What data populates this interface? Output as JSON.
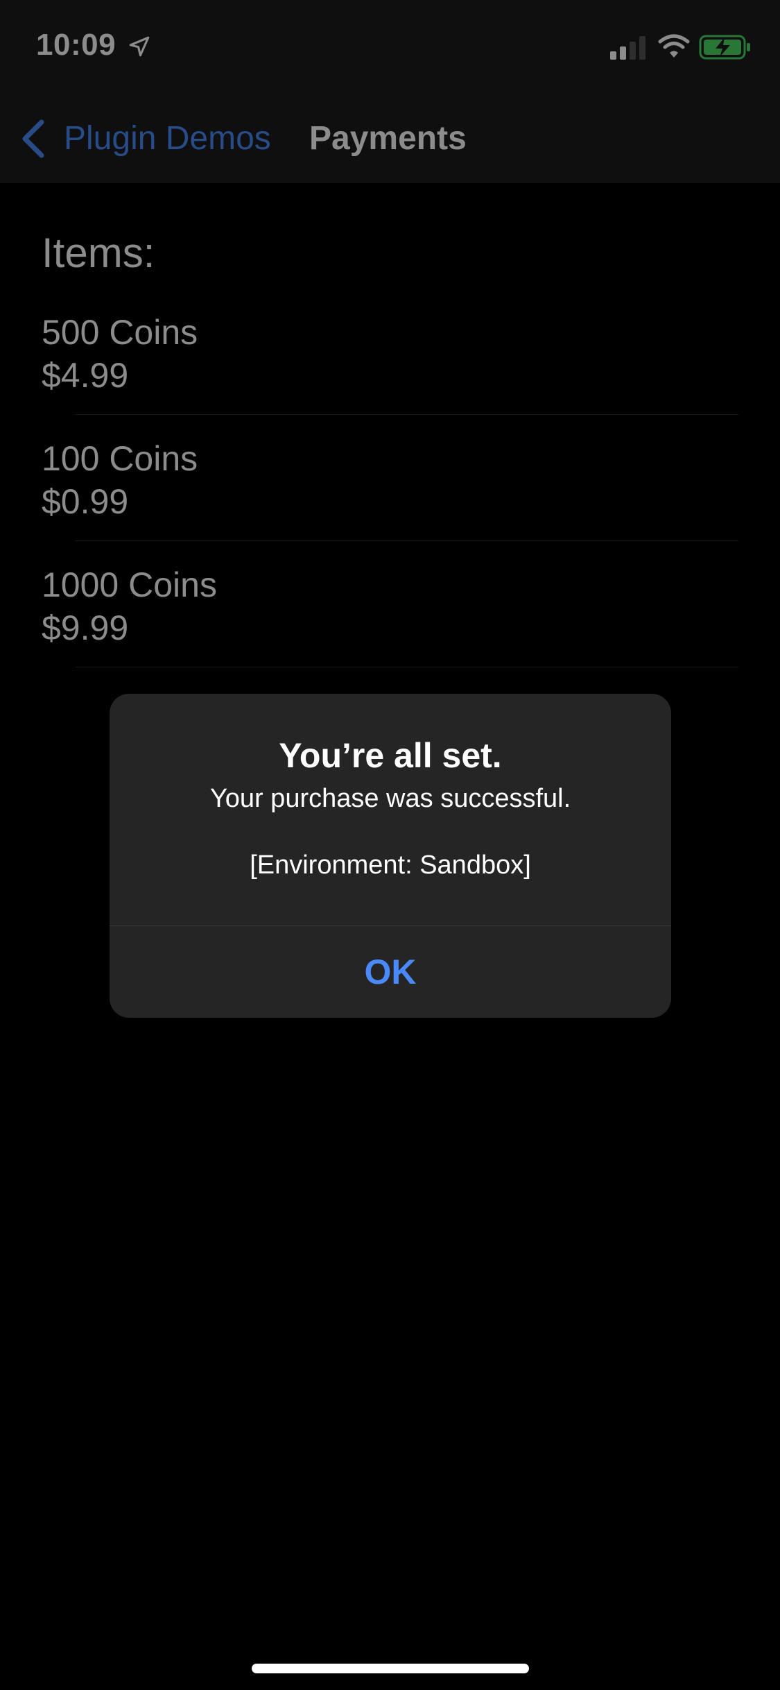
{
  "status": {
    "time": "10:09",
    "icons": [
      "location-arrow-icon",
      "cellular-signal-icon",
      "wifi-icon",
      "battery-charging-icon"
    ]
  },
  "nav": {
    "back_label": "Plugin Demos",
    "title": "Payments"
  },
  "content": {
    "heading": "Items:",
    "items": [
      {
        "name": "500 Coins",
        "price": "$4.99"
      },
      {
        "name": "100 Coins",
        "price": "$0.99"
      },
      {
        "name": "1000 Coins",
        "price": "$9.99"
      }
    ]
  },
  "alert": {
    "title": "You’re all set.",
    "message": "Your purchase was successful.",
    "environment": "[Environment: Sandbox]",
    "ok_label": "OK"
  },
  "colors": {
    "accent": "#4a8af8",
    "background": "#000000",
    "bar": "#1c1c1e",
    "alert_bg": "#252525"
  }
}
